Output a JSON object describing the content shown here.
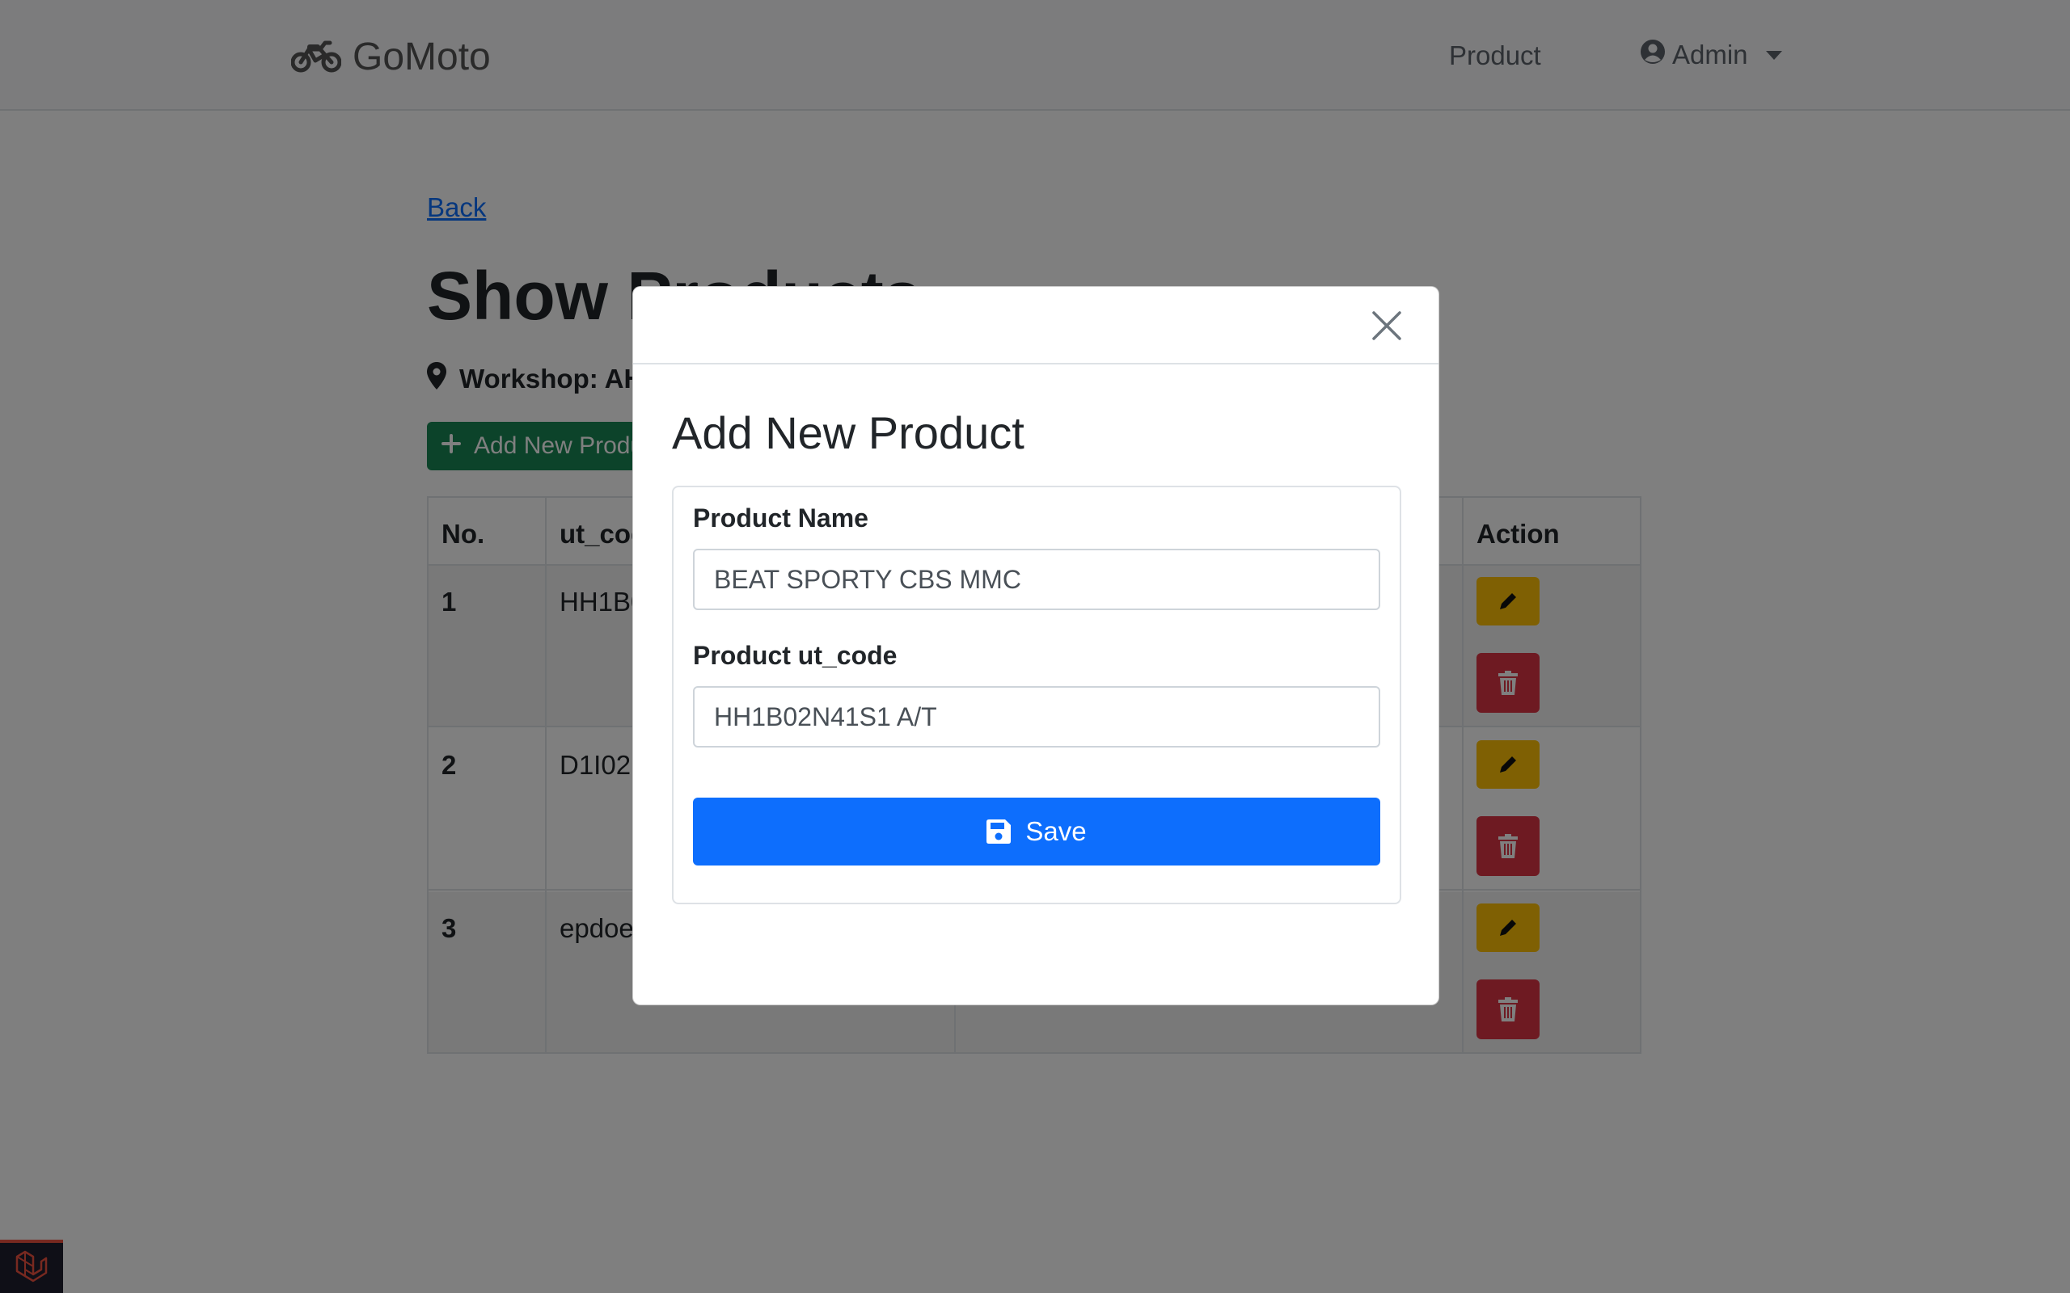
{
  "navbar": {
    "brand": "GoMoto",
    "links": {
      "product": "Product",
      "admin": "Admin"
    }
  },
  "page": {
    "back_label": "Back",
    "title": "Show Products",
    "workshop_label": "Workshop: AH",
    "add_button_label": "Add New Product"
  },
  "table": {
    "headers": {
      "no": "No.",
      "ut_code": "ut_code",
      "action": "Action"
    },
    "rows": [
      {
        "no": "1",
        "ut_code": "HH1B0"
      },
      {
        "no": "2",
        "ut_code": "D1I02N"
      },
      {
        "no": "3",
        "ut_code": "epdoe"
      }
    ]
  },
  "modal": {
    "title": "Add New Product",
    "product_name_label": "Product Name",
    "product_name_value": "BEAT SPORTY CBS MMC",
    "product_code_label": "Product ut_code",
    "product_code_value": "HH1B02N41S1 A/T",
    "save_label": "Save"
  },
  "colors": {
    "primary": "#0d6efd",
    "success": "#198754",
    "warning": "#ffc107",
    "danger": "#dc3545",
    "backdrop": "rgba(0,0,0,0.5)"
  },
  "icons": [
    "motorcycle-icon",
    "user-circle-icon",
    "chevron-down-icon",
    "map-marker-icon",
    "plus-icon",
    "pencil-icon",
    "trash-icon",
    "close-icon",
    "save-icon",
    "laravel-icon"
  ]
}
